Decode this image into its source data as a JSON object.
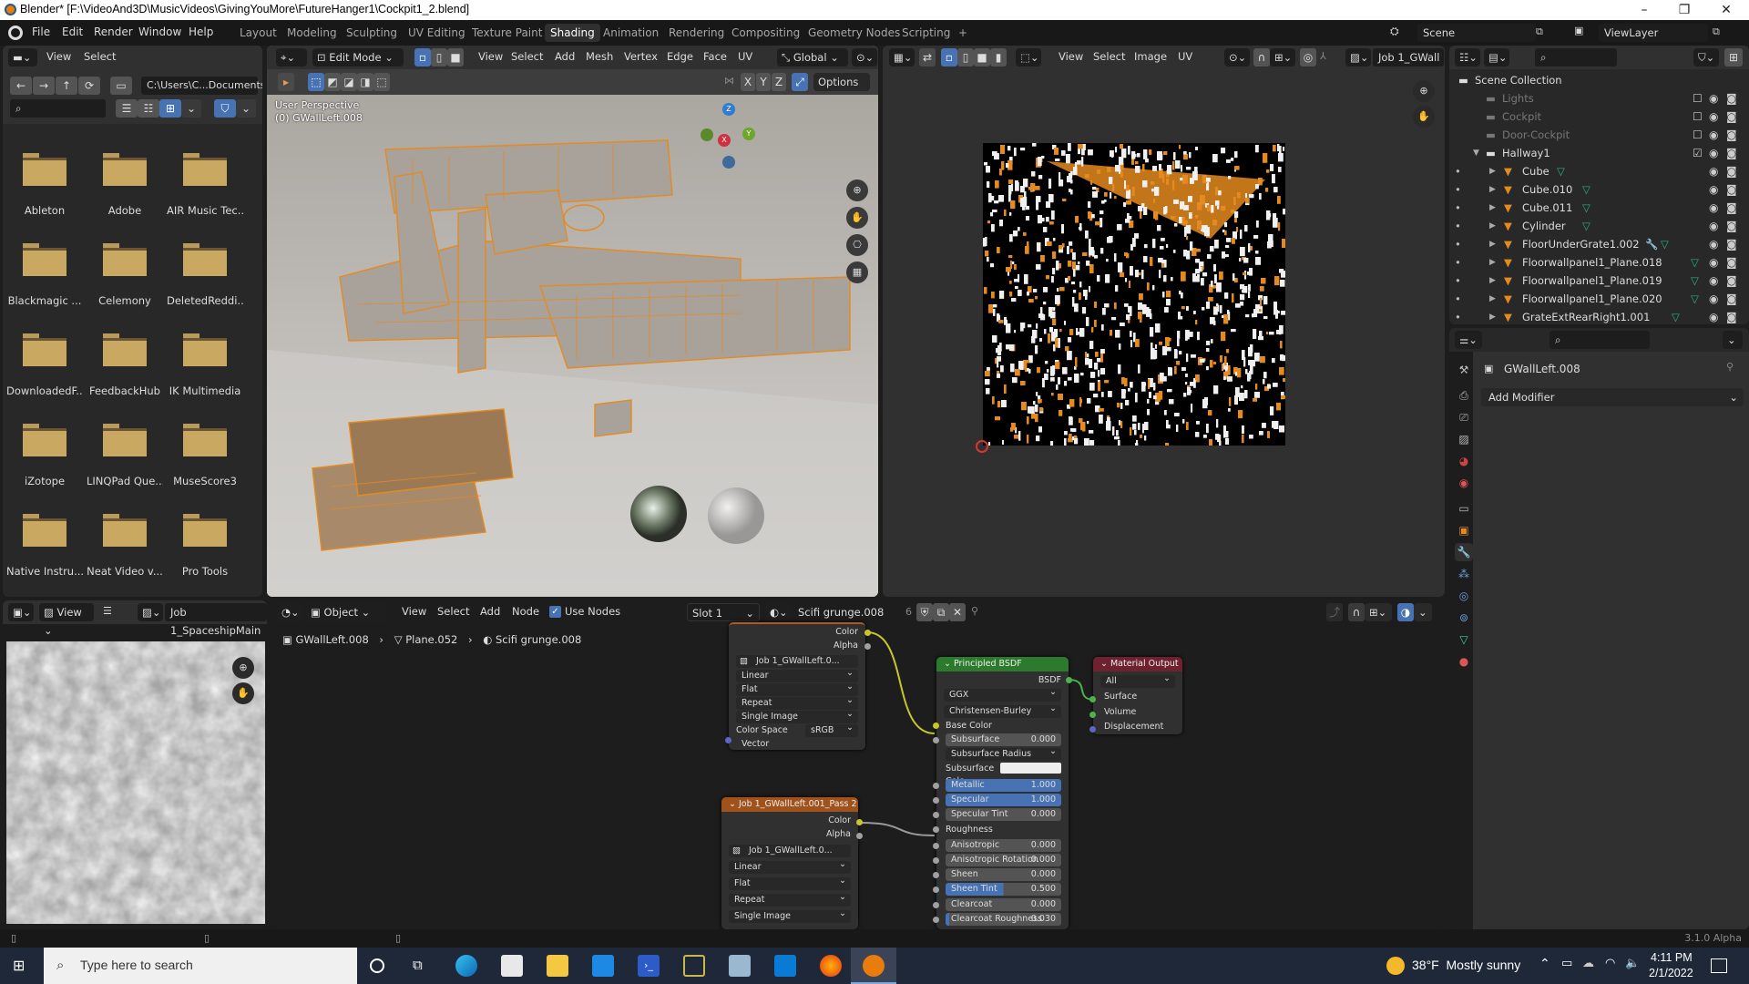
{
  "window": {
    "title": "Blender* [F:\\VideoAnd3D\\MusicVideos\\GivingYouMore\\FutureHanger1\\Cockpit1_2.blend]",
    "minimize": "–",
    "maximize": "❐",
    "close": "✕"
  },
  "topbar": {
    "menus": [
      "File",
      "Edit",
      "Render",
      "Window",
      "Help"
    ],
    "workspaces": [
      "Layout",
      "Modeling",
      "Sculpting",
      "UV Editing",
      "Texture Paint",
      "Shading",
      "Animation",
      "Rendering",
      "Compositing",
      "Geometry Nodes",
      "Scripting"
    ],
    "active_workspace": "Shading",
    "add_workspace": "+",
    "scene": "Scene",
    "view_layer": "ViewLayer"
  },
  "file_browser": {
    "menus": [
      "View",
      "Select"
    ],
    "path": "C:\\Users\\C...Documents\\",
    "search_placeholder": "",
    "folders": [
      "Ableton",
      "Adobe",
      "AIR Music Tec...",
      "Blackmagic ...",
      "Celemony",
      "DeletedReddi...",
      "DownloadedF...",
      "FeedbackHub",
      "IK Multimedia",
      "iZotope",
      "LINQPad Que...",
      "MuseScore3",
      "Native Instru...",
      "Neat Video v...",
      "Pro Tools"
    ]
  },
  "viewport": {
    "mode": "Edit Mode",
    "menus": [
      "View",
      "Select",
      "Add",
      "Mesh",
      "Vertex",
      "Edge",
      "Face",
      "UV"
    ],
    "transform_orientation": "Global",
    "axes": [
      "X",
      "Y",
      "Z"
    ],
    "options_label": "Options",
    "overlay_line1": "User Perspective",
    "overlay_line2": "(0) GWallLeft.008",
    "gizmo": {
      "x": "X",
      "y": "Y",
      "z": "Z"
    }
  },
  "uv_editor": {
    "menus": [
      "View",
      "Select",
      "Image",
      "UV"
    ],
    "image_name": "Job 1_GWall"
  },
  "outliner": {
    "root": "Scene Collection",
    "collections": [
      {
        "name": "Lights",
        "enabled": false
      },
      {
        "name": "Cockpit",
        "enabled": false
      },
      {
        "name": "Door-Cockpit",
        "enabled": false
      },
      {
        "name": "Hallway1",
        "enabled": true
      }
    ],
    "objects": [
      {
        "name": "Cube",
        "modifier": false
      },
      {
        "name": "Cube.010",
        "modifier": false
      },
      {
        "name": "Cube.011",
        "modifier": false
      },
      {
        "name": "Cylinder",
        "modifier": false
      },
      {
        "name": "FloorUnderGrate1.002",
        "modifier": true
      },
      {
        "name": "Floorwallpanel1_Plane.018",
        "modifier": false
      },
      {
        "name": "Floorwallpanel1_Plane.019",
        "modifier": false
      },
      {
        "name": "Floorwallpanel1_Plane.020",
        "modifier": false
      },
      {
        "name": "GrateExtRearRight1.001",
        "modifier": false
      }
    ]
  },
  "properties": {
    "object_name": "GWallLeft.008",
    "add_modifier": "Add Modifier"
  },
  "image_editor": {
    "view_menu": "View",
    "image_name": "Job 1_SpaceshipMain"
  },
  "node_editor": {
    "object_type": "Object",
    "menus": [
      "View",
      "Select",
      "Add",
      "Node"
    ],
    "use_nodes_label": "Use Nodes",
    "use_nodes": true,
    "slot": "Slot 1",
    "material": "Scifi grunge.008",
    "material_users": "6",
    "breadcrumb": [
      "GWallLeft.008",
      "Plane.052",
      "Scifi grunge.008"
    ],
    "image_node_1": {
      "outputs": [
        "Color",
        "Alpha"
      ],
      "image": "Job 1_GWallLeft.0...",
      "interpolation": "Linear",
      "projection": "Flat",
      "extension": "Repeat",
      "source": "Single Image",
      "color_space_label": "Color Space",
      "color_space": "sRGB",
      "input": "Vector"
    },
    "image_node_2": {
      "title": "Job 1_GWallLeft.001_Pass 2",
      "outputs": [
        "Color",
        "Alpha"
      ],
      "image": "Job 1_GWallLeft.0...",
      "interpolation": "Linear",
      "projection": "Flat",
      "extension": "Repeat",
      "source": "Single Image"
    },
    "bsdf": {
      "title": "Principled BSDF",
      "output": "BSDF",
      "distribution": "GGX",
      "subsurface_method": "Christensen-Burley",
      "base_color": "Base Color",
      "subsurface_radius": "Subsurface Radius",
      "subsurface_color": "Subsurface Colo",
      "roughness": "Roughness",
      "params": [
        {
          "label": "Subsurface",
          "value": "0.000",
          "fill": 0
        },
        {
          "label": "Metallic",
          "value": "1.000",
          "fill": 1
        },
        {
          "label": "Specular",
          "value": "1.000",
          "fill": 1
        },
        {
          "label": "Specular Tint",
          "value": "0.000",
          "fill": 0
        },
        {
          "label": "Anisotropic",
          "value": "0.000",
          "fill": 0
        },
        {
          "label": "Anisotropic Rotation",
          "value": "0.000",
          "fill": 0
        },
        {
          "label": "Sheen",
          "value": "0.000",
          "fill": 0
        },
        {
          "label": "Sheen Tint",
          "value": "0.500",
          "fill": 0.5
        },
        {
          "label": "Clearcoat",
          "value": "0.000",
          "fill": 0
        },
        {
          "label": "Clearcoat Roughness",
          "value": "0.030",
          "fill": 0.03
        }
      ]
    },
    "material_output": {
      "title": "Material Output",
      "target": "All",
      "inputs": [
        "Surface",
        "Volume",
        "Displacement"
      ]
    }
  },
  "statusbar": {
    "version": "3.1.0 Alpha"
  },
  "taskbar": {
    "search_placeholder": "Type here to search",
    "weather": "38°F  Mostly sunny",
    "time": "4:11 PM",
    "date": "2/1/2022"
  }
}
